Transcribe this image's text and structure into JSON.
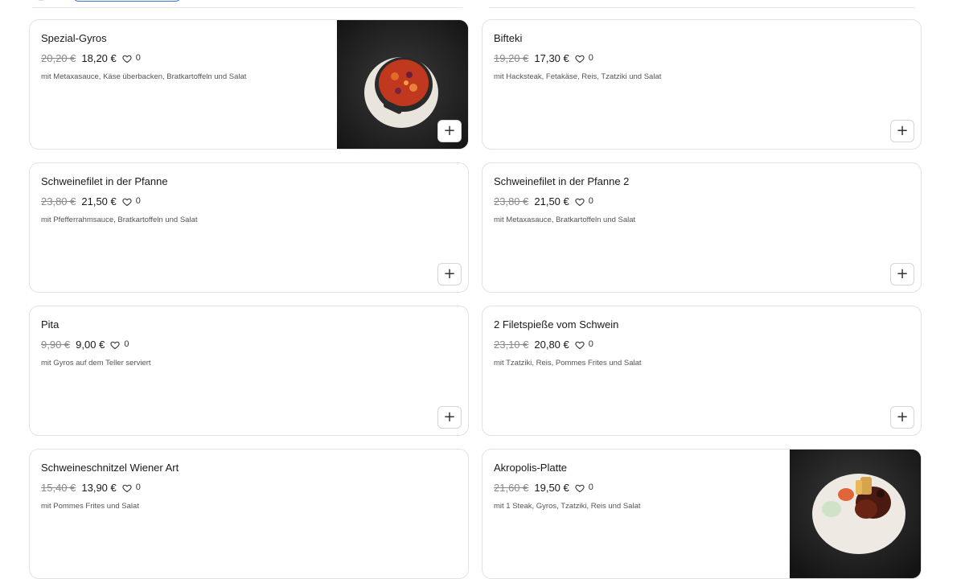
{
  "currency_note": "€",
  "items": [
    {
      "name": "Spezial-Gyros",
      "old_price": "20,20 €",
      "price": "18,20 €",
      "likes": "0",
      "description": "mit Metaxasauce, Käse überbacken, Bratkartoffeln und Salat",
      "has_image": true,
      "image": "gyros-dish-photo",
      "add_label": "+"
    },
    {
      "name": "Bifteki",
      "old_price": "19,20 €",
      "price": "17,30 €",
      "likes": "0",
      "description": "mit Hacksteak, Fetakäse, Reis, Tzatziki und Salat",
      "has_image": false,
      "add_label": "+"
    },
    {
      "name": "Schweinefilet in der Pfanne",
      "old_price": "23,80 €",
      "price": "21,50 €",
      "likes": "0",
      "description": "mit Pfefferrahmsauce, Bratkartoffeln und Salat",
      "has_image": false,
      "add_label": "+"
    },
    {
      "name": "Schweinefilet in der Pfanne 2",
      "old_price": "23,80 €",
      "price": "21,50 €",
      "likes": "0",
      "description": "mit Metaxasauce, Bratkartoffeln und Salat",
      "has_image": false,
      "add_label": "+"
    },
    {
      "name": "Pita",
      "old_price": "9,90 €",
      "price": "9,00 €",
      "likes": "0",
      "description": "mit Gyros auf dem Teller serviert",
      "has_image": false,
      "add_label": "+"
    },
    {
      "name": "2 Filetspieße vom Schwein",
      "old_price": "23,10 €",
      "price": "20,80 €",
      "likes": "0",
      "description": "mit Tzatziki, Reis, Pommes Frites und Salat",
      "has_image": false,
      "add_label": "+"
    },
    {
      "name": "Schweineschnitzel Wiener Art",
      "old_price": "15,40 €",
      "price": "13,90 €",
      "likes": "0",
      "description": "mit Pommes Frites und Salat",
      "has_image": false,
      "add_label": "+"
    },
    {
      "name": "Akropolis-Platte",
      "old_price": "21,60 €",
      "price": "19,50 €",
      "likes": "0",
      "description": "mit 1 Steak, Gyros, Tzatziki, Reis und Salat",
      "has_image": true,
      "image": "akropolis-platter-photo",
      "add_label": "+"
    }
  ],
  "colors": {
    "border": "#e2e2e2",
    "old_price": "#8a8a8a",
    "text": "#1a1a1a",
    "description": "#555555",
    "accent_pill": "#3b6fd6"
  }
}
